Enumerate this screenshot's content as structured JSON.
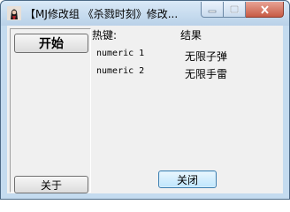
{
  "window": {
    "title": "【MJ修改组 《杀戮时刻》修改..."
  },
  "buttons": {
    "start": "开始",
    "about": "关于",
    "close": "关闭"
  },
  "table": {
    "headers": {
      "hotkey": "热键:",
      "result": "结果"
    },
    "rows": [
      {
        "key": "numeric 1",
        "result": "无限子弹"
      },
      {
        "key": "numeric 2",
        "result": "无限手雷"
      }
    ]
  },
  "colors": {
    "titlebar": "#c4dbef",
    "close_button": "#c75b45",
    "client_bg": "#f0f0f0"
  },
  "icons": [
    "app-icon",
    "minimize-icon",
    "maximize-icon",
    "close-icon"
  ]
}
